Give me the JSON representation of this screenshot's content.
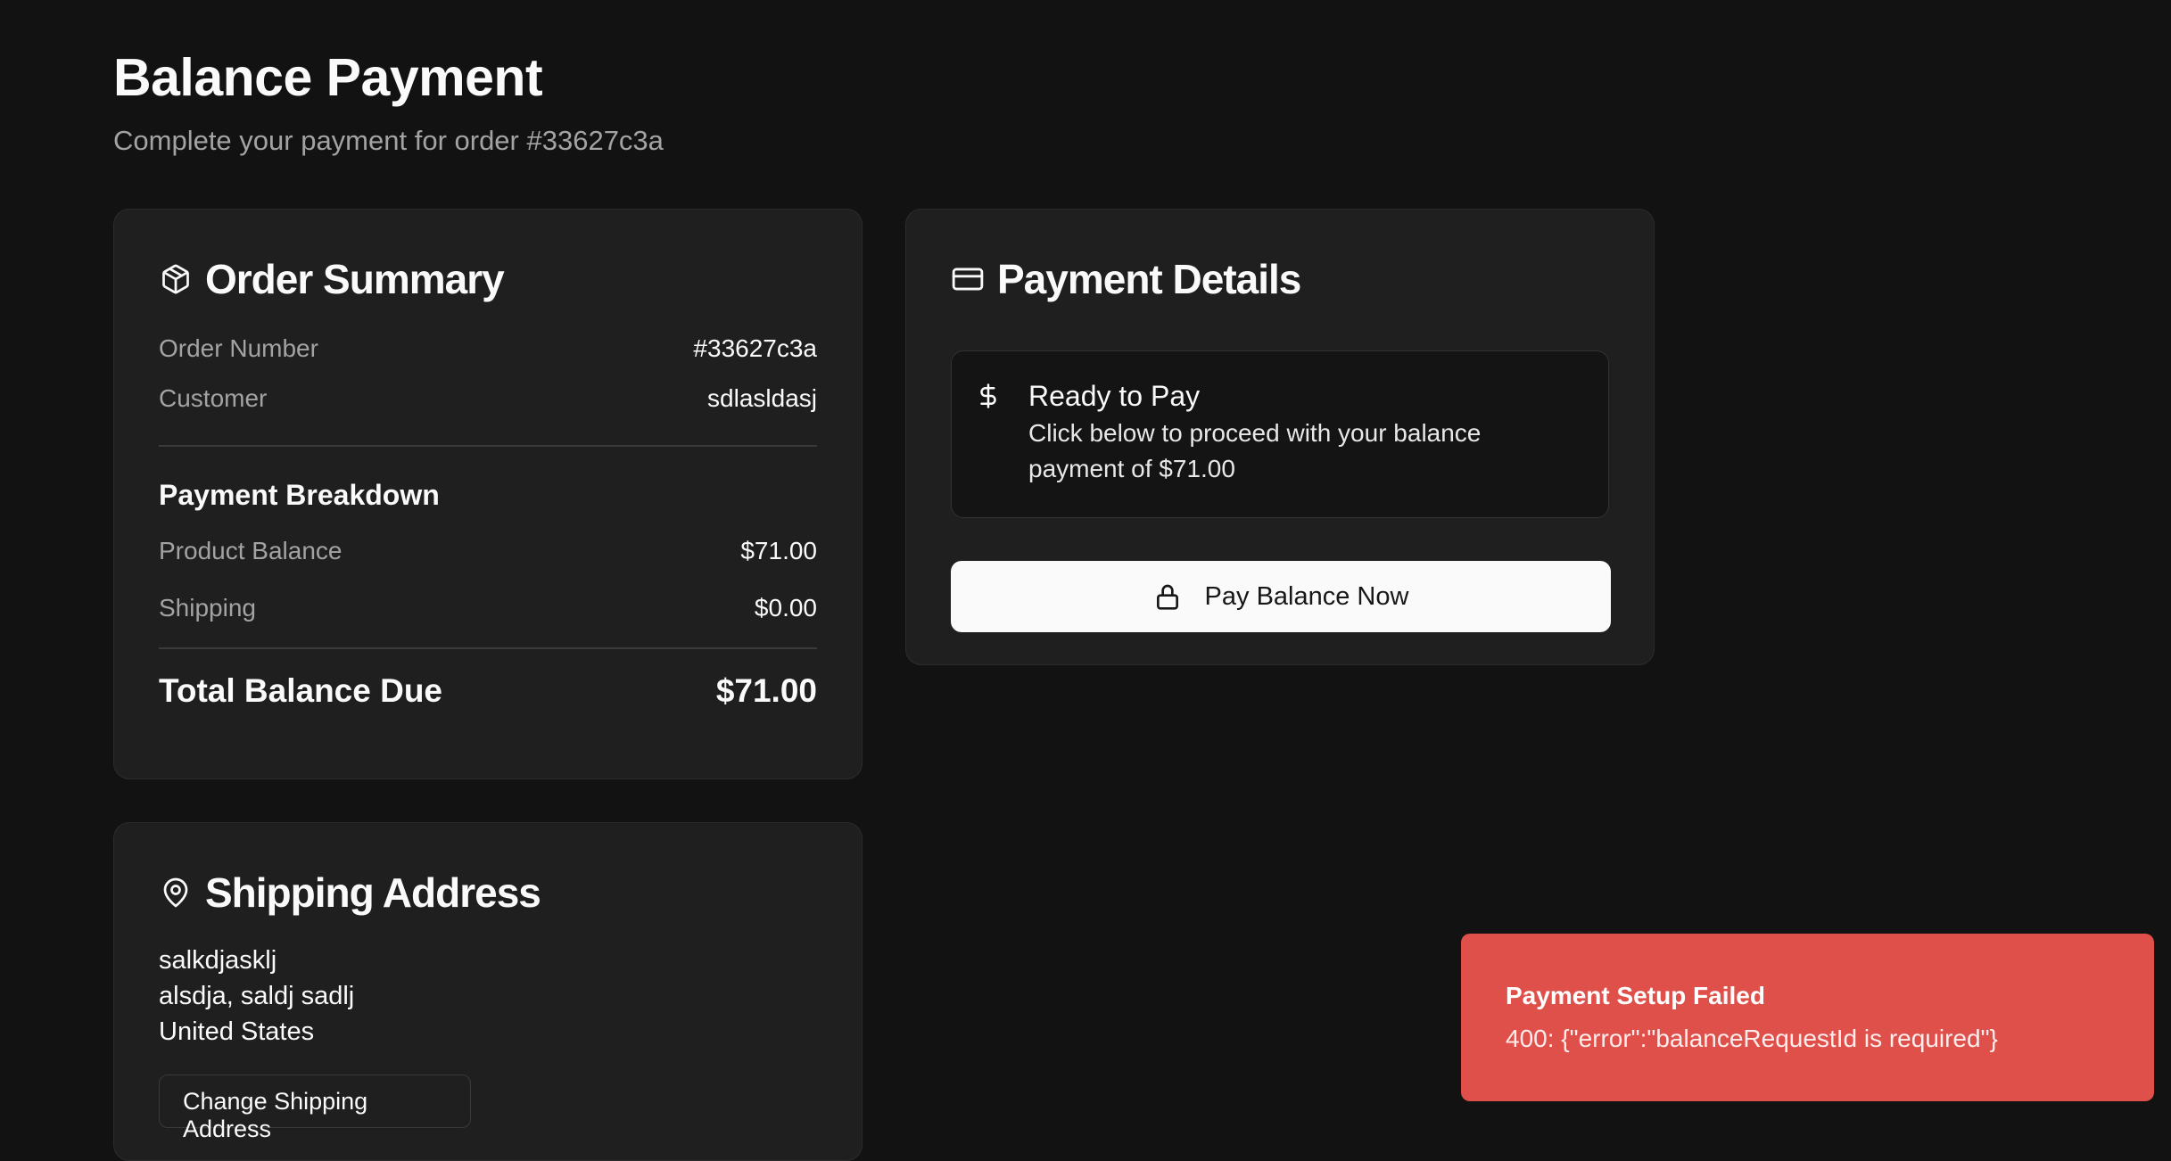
{
  "header": {
    "title": "Balance Payment",
    "subtitle": "Complete your payment for order #33627c3a"
  },
  "order_summary": {
    "title": "Order Summary",
    "icon": "package-icon",
    "order_number_label": "Order Number",
    "order_number_value": "#33627c3a",
    "customer_label": "Customer",
    "customer_value": "sdlasldasj",
    "breakdown_title": "Payment Breakdown",
    "product_balance_label": "Product Balance",
    "product_balance_value": "$71.00",
    "shipping_label": "Shipping",
    "shipping_value": "$0.00",
    "total_label": "Total Balance Due",
    "total_value": "$71.00"
  },
  "payment_details": {
    "title": "Payment Details",
    "icon": "credit-card-icon",
    "ready_title": "Ready to Pay",
    "ready_text": "Click below to proceed with your balance payment of $71.00",
    "pay_button_label": "Pay Balance Now",
    "pay_button_icon": "lock-icon"
  },
  "shipping_address": {
    "title": "Shipping Address",
    "icon": "map-pin-icon",
    "lines": [
      "salkdjasklj",
      "alsdja, saldj sadlj",
      "United States"
    ],
    "change_button_label": "Change Shipping Address"
  },
  "toast": {
    "title": "Payment Setup Failed",
    "message": "400: {\"error\":\"balanceRequestId is required\"}",
    "color": "#e0504a"
  }
}
